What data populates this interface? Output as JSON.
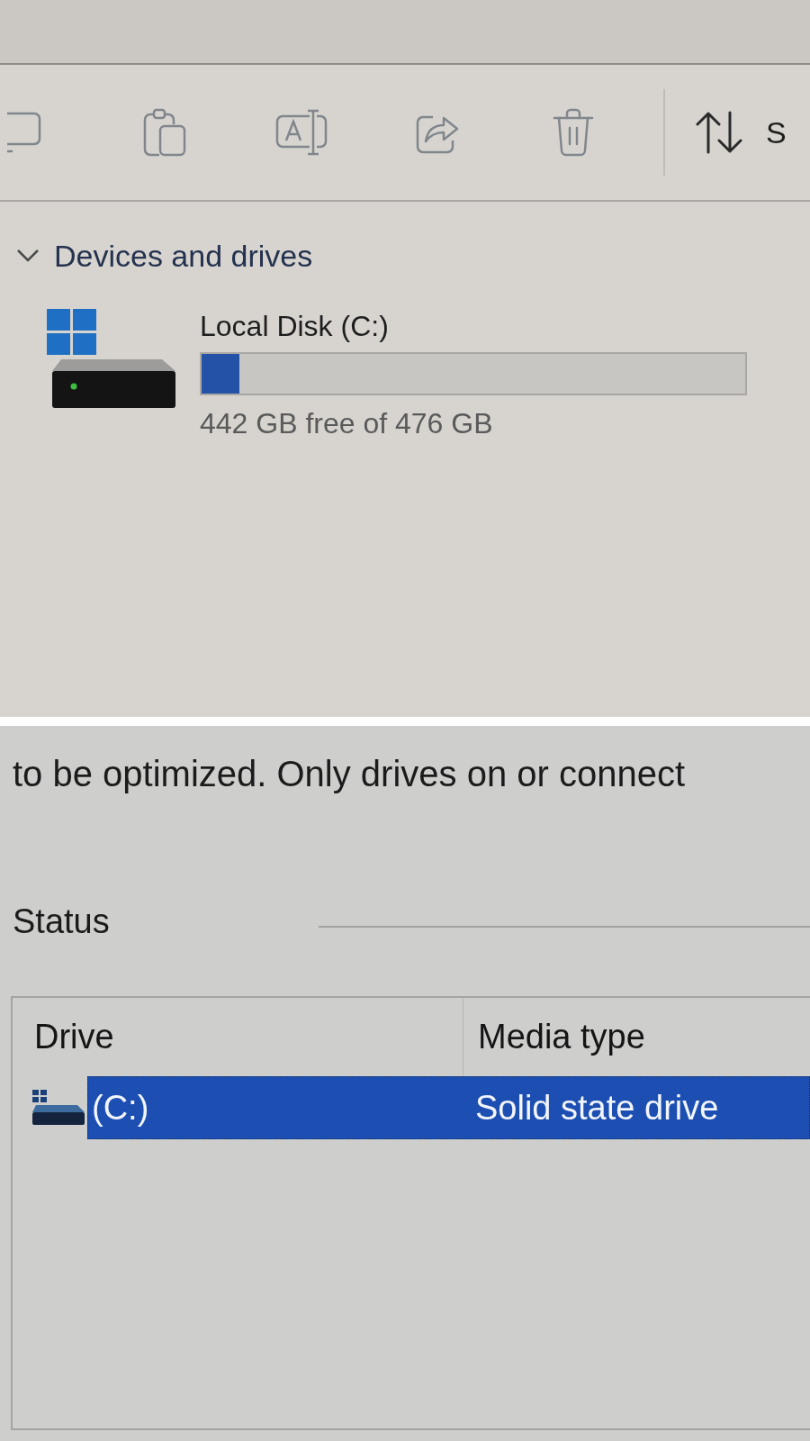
{
  "explorer": {
    "toolbar": {
      "sort_label": "S"
    },
    "section": {
      "title": "Devices and drives",
      "expanded": true
    },
    "drives": [
      {
        "name": "Local Disk (C:)",
        "level": 0.07,
        "space": "442 GB free of 476 GB"
      }
    ]
  },
  "optimize_drives": {
    "description": "to be optimized. Only drives on or connect",
    "status_label": "Status",
    "table": {
      "columns": [
        "Drive",
        "Media type"
      ],
      "rows": [
        {
          "cells": [
            "(C:)",
            "Solid state drive"
          ],
          "selected": true
        }
      ]
    }
  }
}
